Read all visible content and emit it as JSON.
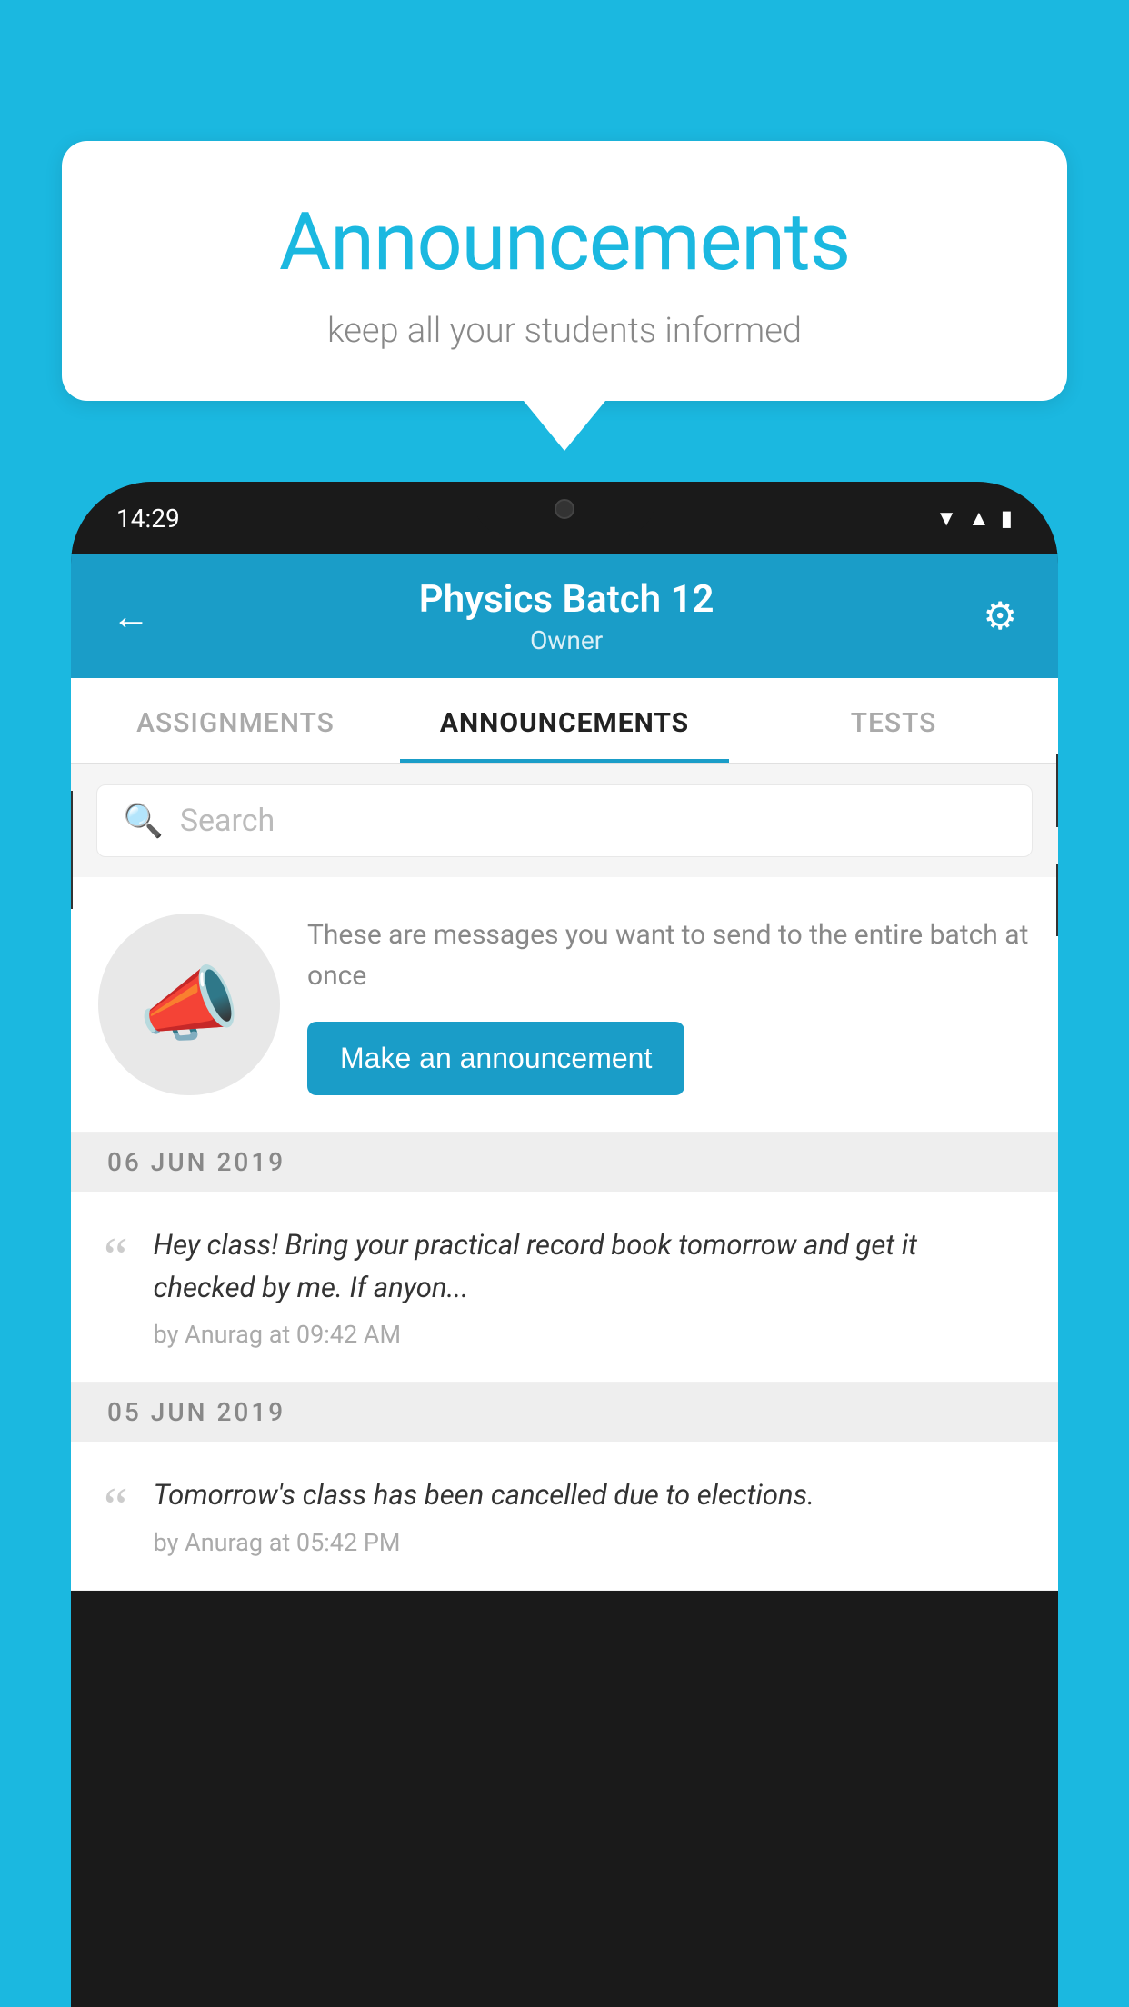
{
  "background_color": "#1bb8e0",
  "speech_bubble": {
    "title": "Announcements",
    "subtitle": "keep all your students informed"
  },
  "phone": {
    "status_bar": {
      "time": "14:29"
    },
    "header": {
      "title": "Physics Batch 12",
      "subtitle": "Owner",
      "back_label": "←",
      "gear_label": "⚙"
    },
    "tabs": [
      {
        "label": "ASSIGNMENTS",
        "active": false
      },
      {
        "label": "ANNOUNCEMENTS",
        "active": true
      },
      {
        "label": "TESTS",
        "active": false
      }
    ],
    "search": {
      "placeholder": "Search"
    },
    "empty_state": {
      "description": "These are messages you want to send to the entire batch at once",
      "button_label": "Make an announcement"
    },
    "date_sections": [
      {
        "date_label": "06  JUN  2019",
        "items": [
          {
            "message": "Hey class! Bring your practical record book tomorrow and get it checked by me. If anyon...",
            "meta": "by Anurag at 09:42 AM"
          }
        ]
      },
      {
        "date_label": "05  JUN  2019",
        "items": [
          {
            "message": "Tomorrow's class has been cancelled due to elections.",
            "meta": "by Anurag at 05:42 PM"
          }
        ]
      }
    ]
  }
}
